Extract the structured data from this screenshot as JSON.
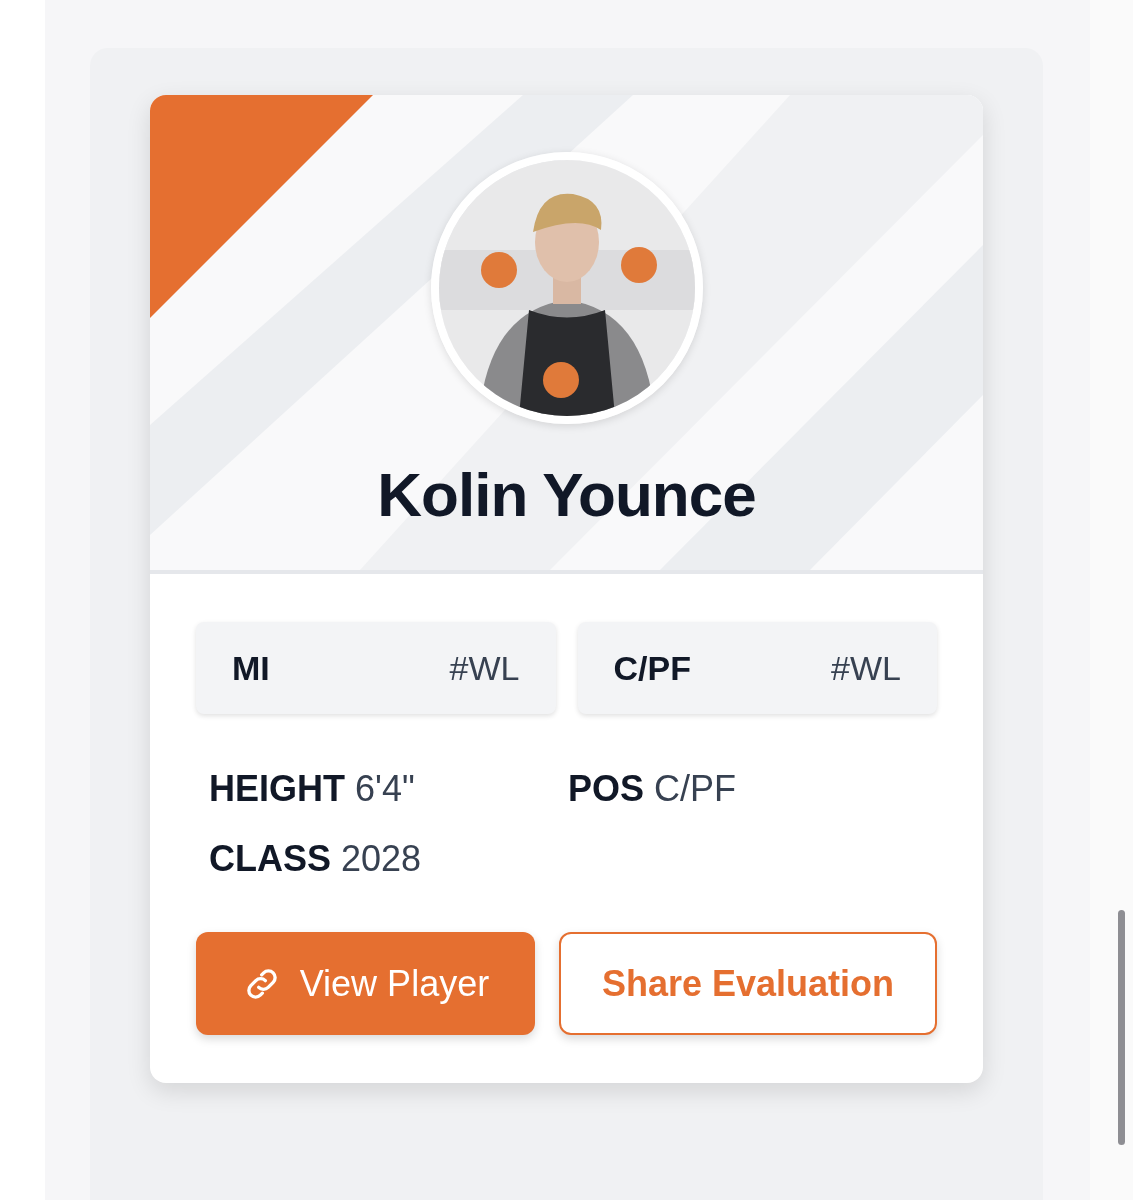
{
  "player": {
    "name": "Kolin Younce"
  },
  "tags": [
    {
      "label": "MI",
      "rank": "#WL"
    },
    {
      "label": "C/PF",
      "rank": "#WL"
    }
  ],
  "stats": [
    {
      "label": "HEIGHT",
      "value": "6'4\""
    },
    {
      "label": "POS",
      "value": "C/PF"
    },
    {
      "label": "CLASS",
      "value": "2028"
    }
  ],
  "buttons": [
    {
      "label": "View Player",
      "kind": "primary"
    },
    {
      "label": "Share Evaluation",
      "kind": "outline"
    }
  ]
}
